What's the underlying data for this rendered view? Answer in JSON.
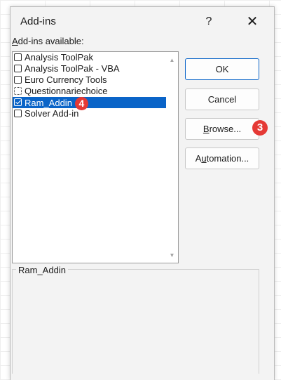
{
  "dialog": {
    "title": "Add-ins",
    "help_label": "?",
    "close_label": "✕",
    "available_label_accel": "A",
    "available_label_rest": "dd-ins available:"
  },
  "addins": [
    {
      "label": "Analysis ToolPak",
      "checked": false
    },
    {
      "label": "Analysis ToolPak - VBA",
      "checked": false
    },
    {
      "label": "Euro Currency Tools",
      "checked": false
    },
    {
      "label": "Questionnariechoice",
      "checked": false
    },
    {
      "label": "Ram_Addin",
      "checked": true,
      "selected": true
    },
    {
      "label": "Solver Add-in",
      "checked": false
    }
  ],
  "buttons": {
    "ok": "OK",
    "cancel": "Cancel",
    "browse_accel": "B",
    "browse_rest": "rowse...",
    "automation_pre": "A",
    "automation_accel": "u",
    "automation_rest": "tomation..."
  },
  "badges": {
    "selected_item": "4",
    "browse": "3",
    "color": "#e53935"
  },
  "description": {
    "name": "Ram_Addin"
  },
  "colors": {
    "selection": "#0a64c8",
    "dialog_bg": "#f3f3f3"
  },
  "scrollbar": {
    "up_icon": "▲",
    "down_icon": "▼"
  }
}
